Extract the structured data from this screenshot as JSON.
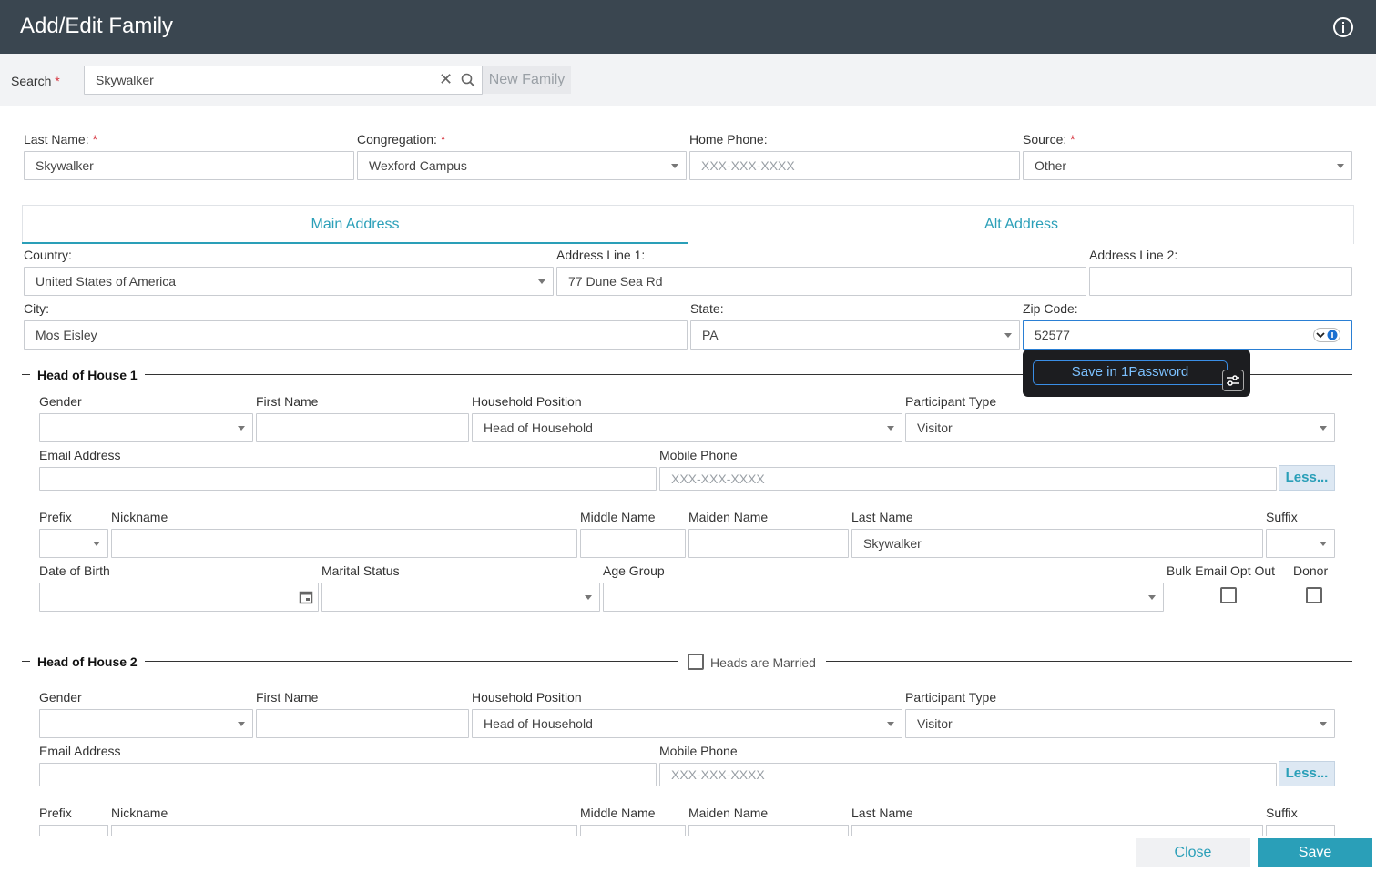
{
  "header": {
    "title": "Add/Edit Family"
  },
  "search": {
    "label": "Search",
    "value": "Skywalker",
    "new_family_label": "New Family"
  },
  "family": {
    "last_name_label": "Last Name:",
    "last_name_value": "Skywalker",
    "congregation_label": "Congregation:",
    "congregation_value": "Wexford Campus",
    "home_phone_label": "Home Phone:",
    "home_phone_placeholder": "XXX-XXX-XXXX",
    "source_label": "Source:",
    "source_value": "Other"
  },
  "tabs": {
    "main": "Main Address",
    "alt": "Alt Address"
  },
  "address": {
    "country_label": "Country:",
    "country_value": "United States of America",
    "line1_label": "Address Line 1:",
    "line1_value": "77 Dune Sea Rd",
    "line2_label": "Address Line 2:",
    "line2_value": "",
    "city_label": "City:",
    "city_value": "Mos Eisley",
    "state_label": "State:",
    "state_value": "PA",
    "zip_label": "Zip Code:",
    "zip_value": "52577"
  },
  "popup": {
    "save_label": "Save in 1Password"
  },
  "hoh1": {
    "title": "Head of House 1",
    "gender_label": "Gender",
    "first_name_label": "First Name",
    "household_position_label": "Household Position",
    "household_position_value": "Head of Household",
    "participant_type_label": "Participant Type",
    "participant_type_value": "Visitor",
    "email_label": "Email Address",
    "mobile_label": "Mobile Phone",
    "mobile_placeholder": "XXX-XXX-XXXX",
    "less_label": "Less...",
    "prefix_label": "Prefix",
    "nickname_label": "Nickname",
    "middle_name_label": "Middle Name",
    "maiden_name_label": "Maiden Name",
    "last_name_label": "Last Name",
    "last_name_value": "Skywalker",
    "suffix_label": "Suffix",
    "dob_label": "Date of Birth",
    "marital_label": "Marital Status",
    "age_group_label": "Age Group",
    "bulk_email_label": "Bulk Email Opt Out",
    "donor_label": "Donor"
  },
  "hoh2": {
    "title": "Head of House 2",
    "married_label": "Heads are Married",
    "gender_label": "Gender",
    "first_name_label": "First Name",
    "household_position_label": "Household Position",
    "household_position_value": "Head of Household",
    "participant_type_label": "Participant Type",
    "participant_type_value": "Visitor",
    "email_label": "Email Address",
    "mobile_label": "Mobile Phone",
    "mobile_placeholder": "XXX-XXX-XXXX",
    "less_label": "Less...",
    "prefix_label": "Prefix",
    "nickname_label": "Nickname",
    "middle_name_label": "Middle Name",
    "maiden_name_label": "Maiden Name",
    "last_name_label": "Last Name",
    "suffix_label": "Suffix"
  },
  "footer": {
    "close_label": "Close",
    "save_label": "Save"
  },
  "colors": {
    "header_bg": "#3a4650",
    "accent": "#2a9fb8",
    "required": "#d6313c"
  },
  "icons": [
    "info-icon",
    "clear-icon",
    "search-icon",
    "calendar-icon",
    "chevron-down-icon",
    "settings-sliders-icon"
  ]
}
